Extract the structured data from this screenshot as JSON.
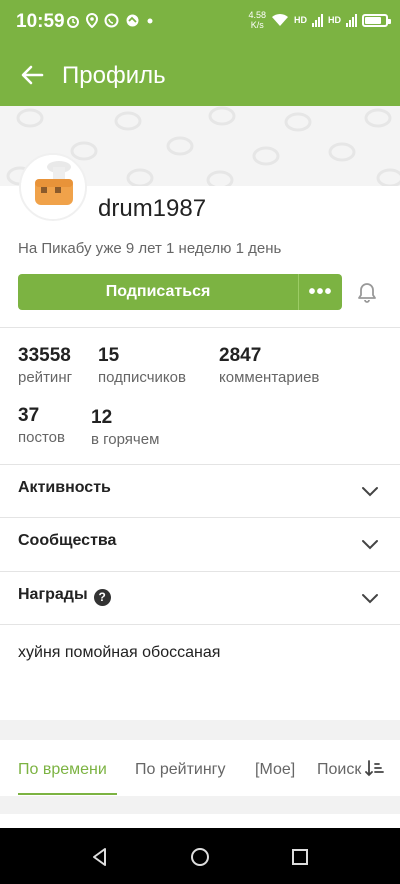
{
  "status_bar": {
    "time": "10:59",
    "left_icons": [
      "alarm-icon",
      "location-icon",
      "whatsapp-icon",
      "app-notification-icon",
      "more-dot"
    ],
    "net_speed_value": "4.58",
    "net_speed_unit": "K/s",
    "hd1": "HD",
    "hd2": "HD"
  },
  "app_bar": {
    "title": "Профиль"
  },
  "profile": {
    "username": "drum1987",
    "member_since": "На Пикабу уже 9 лет 1 неделю 1 день",
    "subscribe_label": "Подписаться",
    "more_label": "•••"
  },
  "stats": [
    {
      "value": "33558",
      "label": "рейтинг"
    },
    {
      "value": "15",
      "label": "подписчиков"
    },
    {
      "value": "2847",
      "label": "комментариев"
    },
    {
      "value": "37",
      "label": "постов"
    },
    {
      "value": "12",
      "label": "в горячем"
    }
  ],
  "sections": [
    {
      "label": "Активность"
    },
    {
      "label": "Сообщества"
    },
    {
      "label": "Награды"
    }
  ],
  "help_glyph": "?",
  "bio": "хуйня помойная обоссаная",
  "tabs": [
    {
      "label": "По времени",
      "active": true
    },
    {
      "label": "По рейтингу",
      "active": false
    },
    {
      "label": "[Мое]",
      "active": false
    },
    {
      "label": "Поиск",
      "active": false
    }
  ],
  "colors": {
    "accent": "#7cb342",
    "text": "#222222",
    "muted": "#666666",
    "background": "#ffffff",
    "band": "#f2f2f2"
  }
}
